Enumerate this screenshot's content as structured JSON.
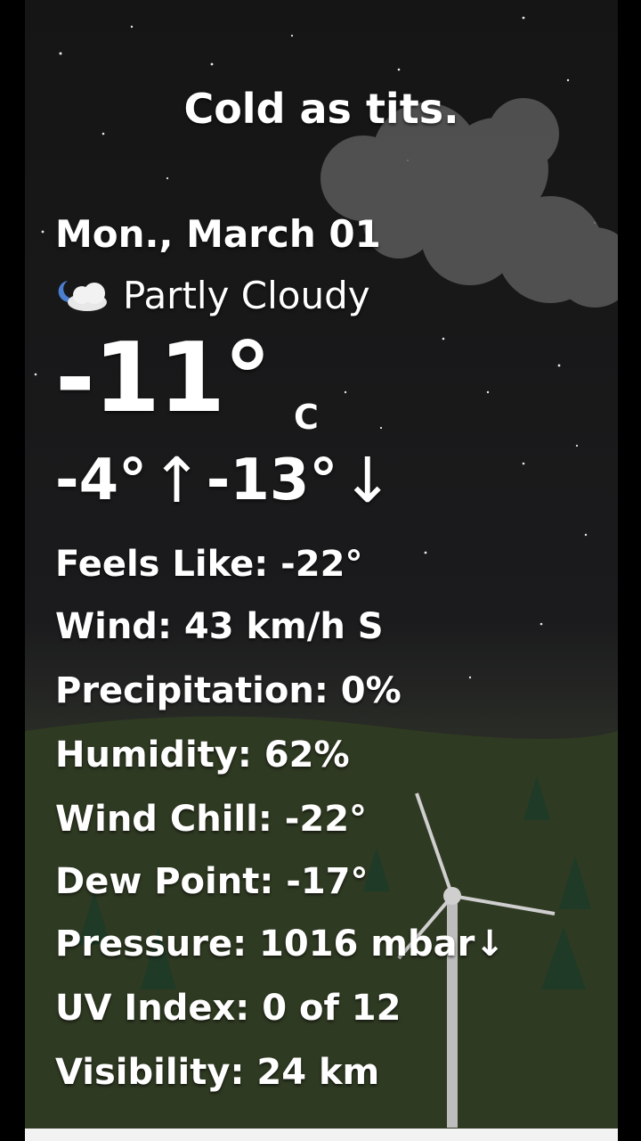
{
  "header": {
    "title": "Cold as tits."
  },
  "weather": {
    "date": "Mon., March 01",
    "condition": "Partly Cloudy",
    "condition_icon": "moon-cloud-icon",
    "temperature": "-11°",
    "unit": "C",
    "high": "-4°",
    "low": "-13°",
    "high_arrow": "↑",
    "low_arrow": "↓"
  },
  "details": {
    "feels_like": "Feels Like: -22°",
    "wind": "Wind: 43 km/h S",
    "precipitation": "Precipitation: 0%",
    "humidity": "Humidity: 62%",
    "wind_chill": "Wind Chill: -22°",
    "dew_point": "Dew Point: -17°",
    "pressure": "Pressure: 1016 mbar↓",
    "uv_index": "UV Index: 0 of 12",
    "visibility": "Visibility: 24 km"
  },
  "colors": {
    "text": "#ffffff",
    "sky": "#151515",
    "ground": "#33401f",
    "cloud": "#5a5a5a"
  }
}
